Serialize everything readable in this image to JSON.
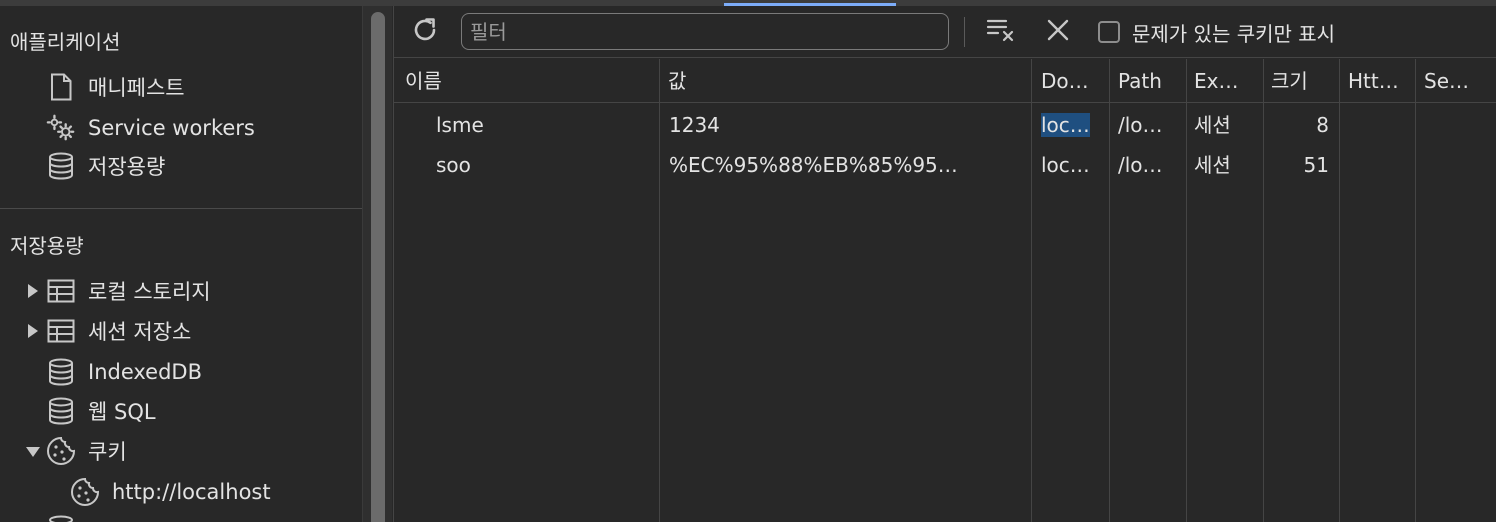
{
  "sidebar": {
    "app_section_title": "애플리케이션",
    "app_items": [
      {
        "label": "매니페스트",
        "icon": "document-icon"
      },
      {
        "label": "Service workers",
        "icon": "gears-icon"
      },
      {
        "label": "저장용량",
        "icon": "database-icon"
      }
    ],
    "storage_section_title": "저장용량",
    "storage_items": [
      {
        "label": "로컬 스토리지",
        "icon": "table-icon",
        "expanded": false
      },
      {
        "label": "세션 저장소",
        "icon": "table-icon",
        "expanded": false
      },
      {
        "label": "IndexedDB",
        "icon": "database-icon"
      },
      {
        "label": "웹 SQL",
        "icon": "database-icon"
      },
      {
        "label": "쿠키",
        "icon": "cookie-icon",
        "expanded": true
      },
      {
        "label": "http://localhost",
        "icon": "cookie-icon"
      }
    ]
  },
  "toolbar": {
    "refresh_icon": "refresh-icon",
    "filter_placeholder": "필터",
    "filter_value": "",
    "clear_filtered_icon": "clear-filtered-icon",
    "delete_icon": "close-icon",
    "issues_only_checked": false,
    "issues_only_label": "문제가 있는 쿠키만 표시"
  },
  "table": {
    "columns": [
      "이름",
      "값",
      "Do…",
      "Path",
      "Ex…",
      "크기",
      "Htt…",
      "Se…"
    ],
    "rows": [
      {
        "name": "lsme",
        "value": "1234",
        "domain": "loc…",
        "path": "/lo…",
        "expires": "세션",
        "size": "8",
        "http": "",
        "secure": ""
      },
      {
        "name": "soo",
        "value": "%EC%95%88%EB%85%95…",
        "domain": "loc…",
        "path": "/lo…",
        "expires": "세션",
        "size": "51",
        "http": "",
        "secure": ""
      }
    ]
  },
  "colors": {
    "background": "#282828",
    "accent": "#7cacf8",
    "selection": "#1f4f80",
    "border": "#454545"
  }
}
